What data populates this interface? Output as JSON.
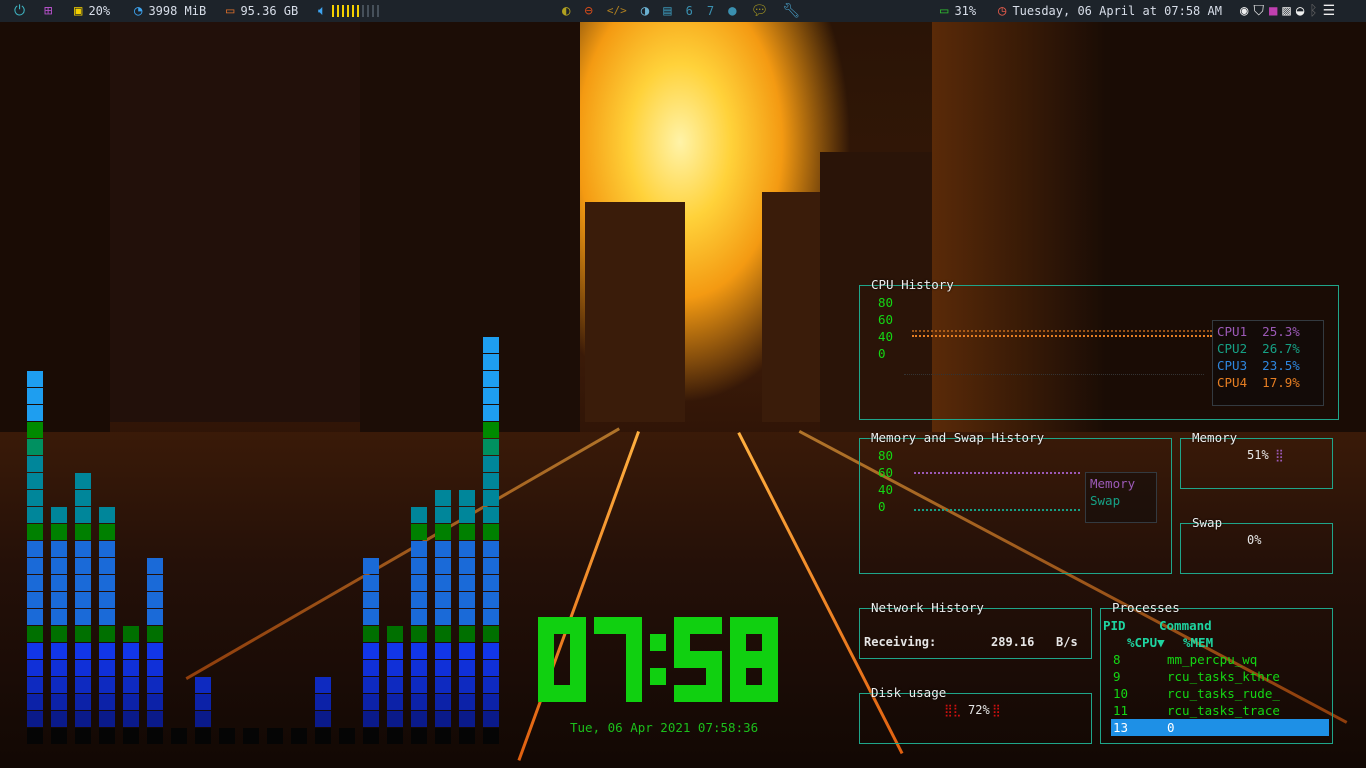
{
  "topbar": {
    "cpu": "20%",
    "memory": "3998 MiB",
    "disk": "95.36 GB",
    "volume_level": 0.6,
    "workspaces": [
      "6",
      "7"
    ],
    "battery": "31%",
    "datetime": "Tuesday, 06 April at 07:58 AM",
    "icons_left": [
      "power-icon",
      "apps-grid-icon",
      "cpu-icon",
      "memory-pie-icon",
      "disk-icon",
      "volume-icon"
    ],
    "icons_center": [
      "firefox-icon",
      "gamepad-icon",
      "code-icon",
      "settings-icon",
      "monitor-icon",
      "github-icon",
      "chat-icon",
      "wrench-icon"
    ],
    "icons_tray": [
      "discord-icon",
      "shield-icon",
      "app-icon",
      "image-viewer-icon",
      "wifi-icon",
      "bluetooth-icon",
      "notes-icon"
    ],
    "colors": {
      "bg": "#1d232a",
      "accent_yellow": "#f4d000"
    }
  },
  "visualizer": {
    "levels": [
      90,
      58,
      65,
      56,
      27,
      43,
      3,
      17,
      1,
      1,
      1,
      1,
      17,
      3,
      44,
      27,
      56,
      63,
      61,
      98
    ]
  },
  "clock": {
    "time": "07:58",
    "date": "Tue, 06 Apr 2021 07:58:36"
  },
  "cpu_history": {
    "title": "CPU History",
    "axis": [
      "80",
      "60",
      "40",
      "0"
    ],
    "legend": [
      {
        "name": "CPU1",
        "value": "25.3%",
        "color": "#9b59b6"
      },
      {
        "name": "CPU2",
        "value": "26.7%",
        "color": "#16a085"
      },
      {
        "name": "CPU3",
        "value": "23.5%",
        "color": "#2e86de"
      },
      {
        "name": "CPU4",
        "value": "17.9%",
        "color": "#e67e22"
      }
    ]
  },
  "mem_history": {
    "title": "Memory and Swap History",
    "axis": [
      "80",
      "60",
      "40",
      "0"
    ],
    "legend": [
      {
        "name": "Memory",
        "color": "#9b59b6"
      },
      {
        "name": "Swap",
        "color": "#16a085"
      }
    ]
  },
  "memory": {
    "title": "Memory",
    "value": "51%",
    "fraction": 0.51
  },
  "swap": {
    "title": "Swap",
    "value": "0%",
    "fraction": 0
  },
  "network": {
    "title": "Network History",
    "label": "Receiving:",
    "value": "289.16",
    "unit": "B/s"
  },
  "disk": {
    "title": "Disk usage",
    "value": "72%",
    "fraction": 0.72
  },
  "processes": {
    "title": "Processes",
    "headers": {
      "pid": "PID",
      "command": "Command",
      "cpu": "%CPU▼",
      "mem": "%MEM"
    },
    "rows": [
      {
        "pid": "8",
        "cmd": "mm_percpu_wq"
      },
      {
        "pid": "9",
        "cmd": "rcu_tasks_kthre"
      },
      {
        "pid": "10",
        "cmd": "rcu_tasks_rude_"
      },
      {
        "pid": "11",
        "cmd": "rcu_tasks_trace"
      },
      {
        "pid": "13",
        "cmd": "0"
      }
    ],
    "selected": 4
  }
}
